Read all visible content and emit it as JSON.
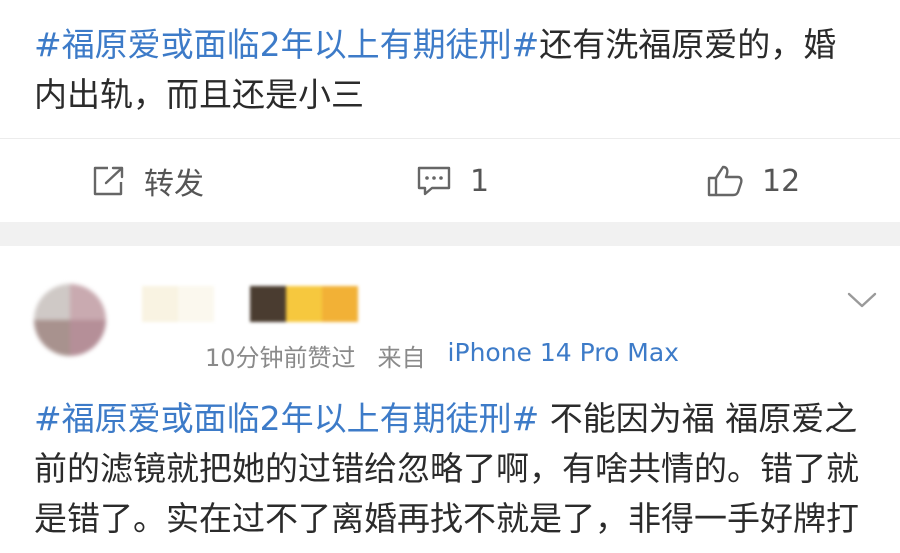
{
  "post1": {
    "hashtag": "#福原爱或面临2年以上有期徒刑#",
    "body": "还有洗福原爱的，婚内出轨，而且还是小三",
    "actions": {
      "repost_label": "转发",
      "comment_count": "1",
      "like_count": "12"
    }
  },
  "post2": {
    "time_text": "10分钟前赞过",
    "source_label": "来自",
    "device": "iPhone 14 Pro Max",
    "hashtag": "#福原爱或面临2年以上有期徒刑#",
    "body": " 不能因为福 福原爱之前的滤镜就把她的过错给忽略了啊，有啥共情的。错了就是错了。实在过不了离婚再找不就是了，非得一手好牌打"
  },
  "colors": {
    "link": "#3d7bc8",
    "text": "#2b2b2b",
    "meta": "#8a8a8a",
    "separator": "#f1f1f1"
  },
  "icons": {
    "repost": "share-out-icon",
    "comment": "comment-icon",
    "like": "thumbs-up-icon",
    "menu": "chevron-down-icon"
  }
}
